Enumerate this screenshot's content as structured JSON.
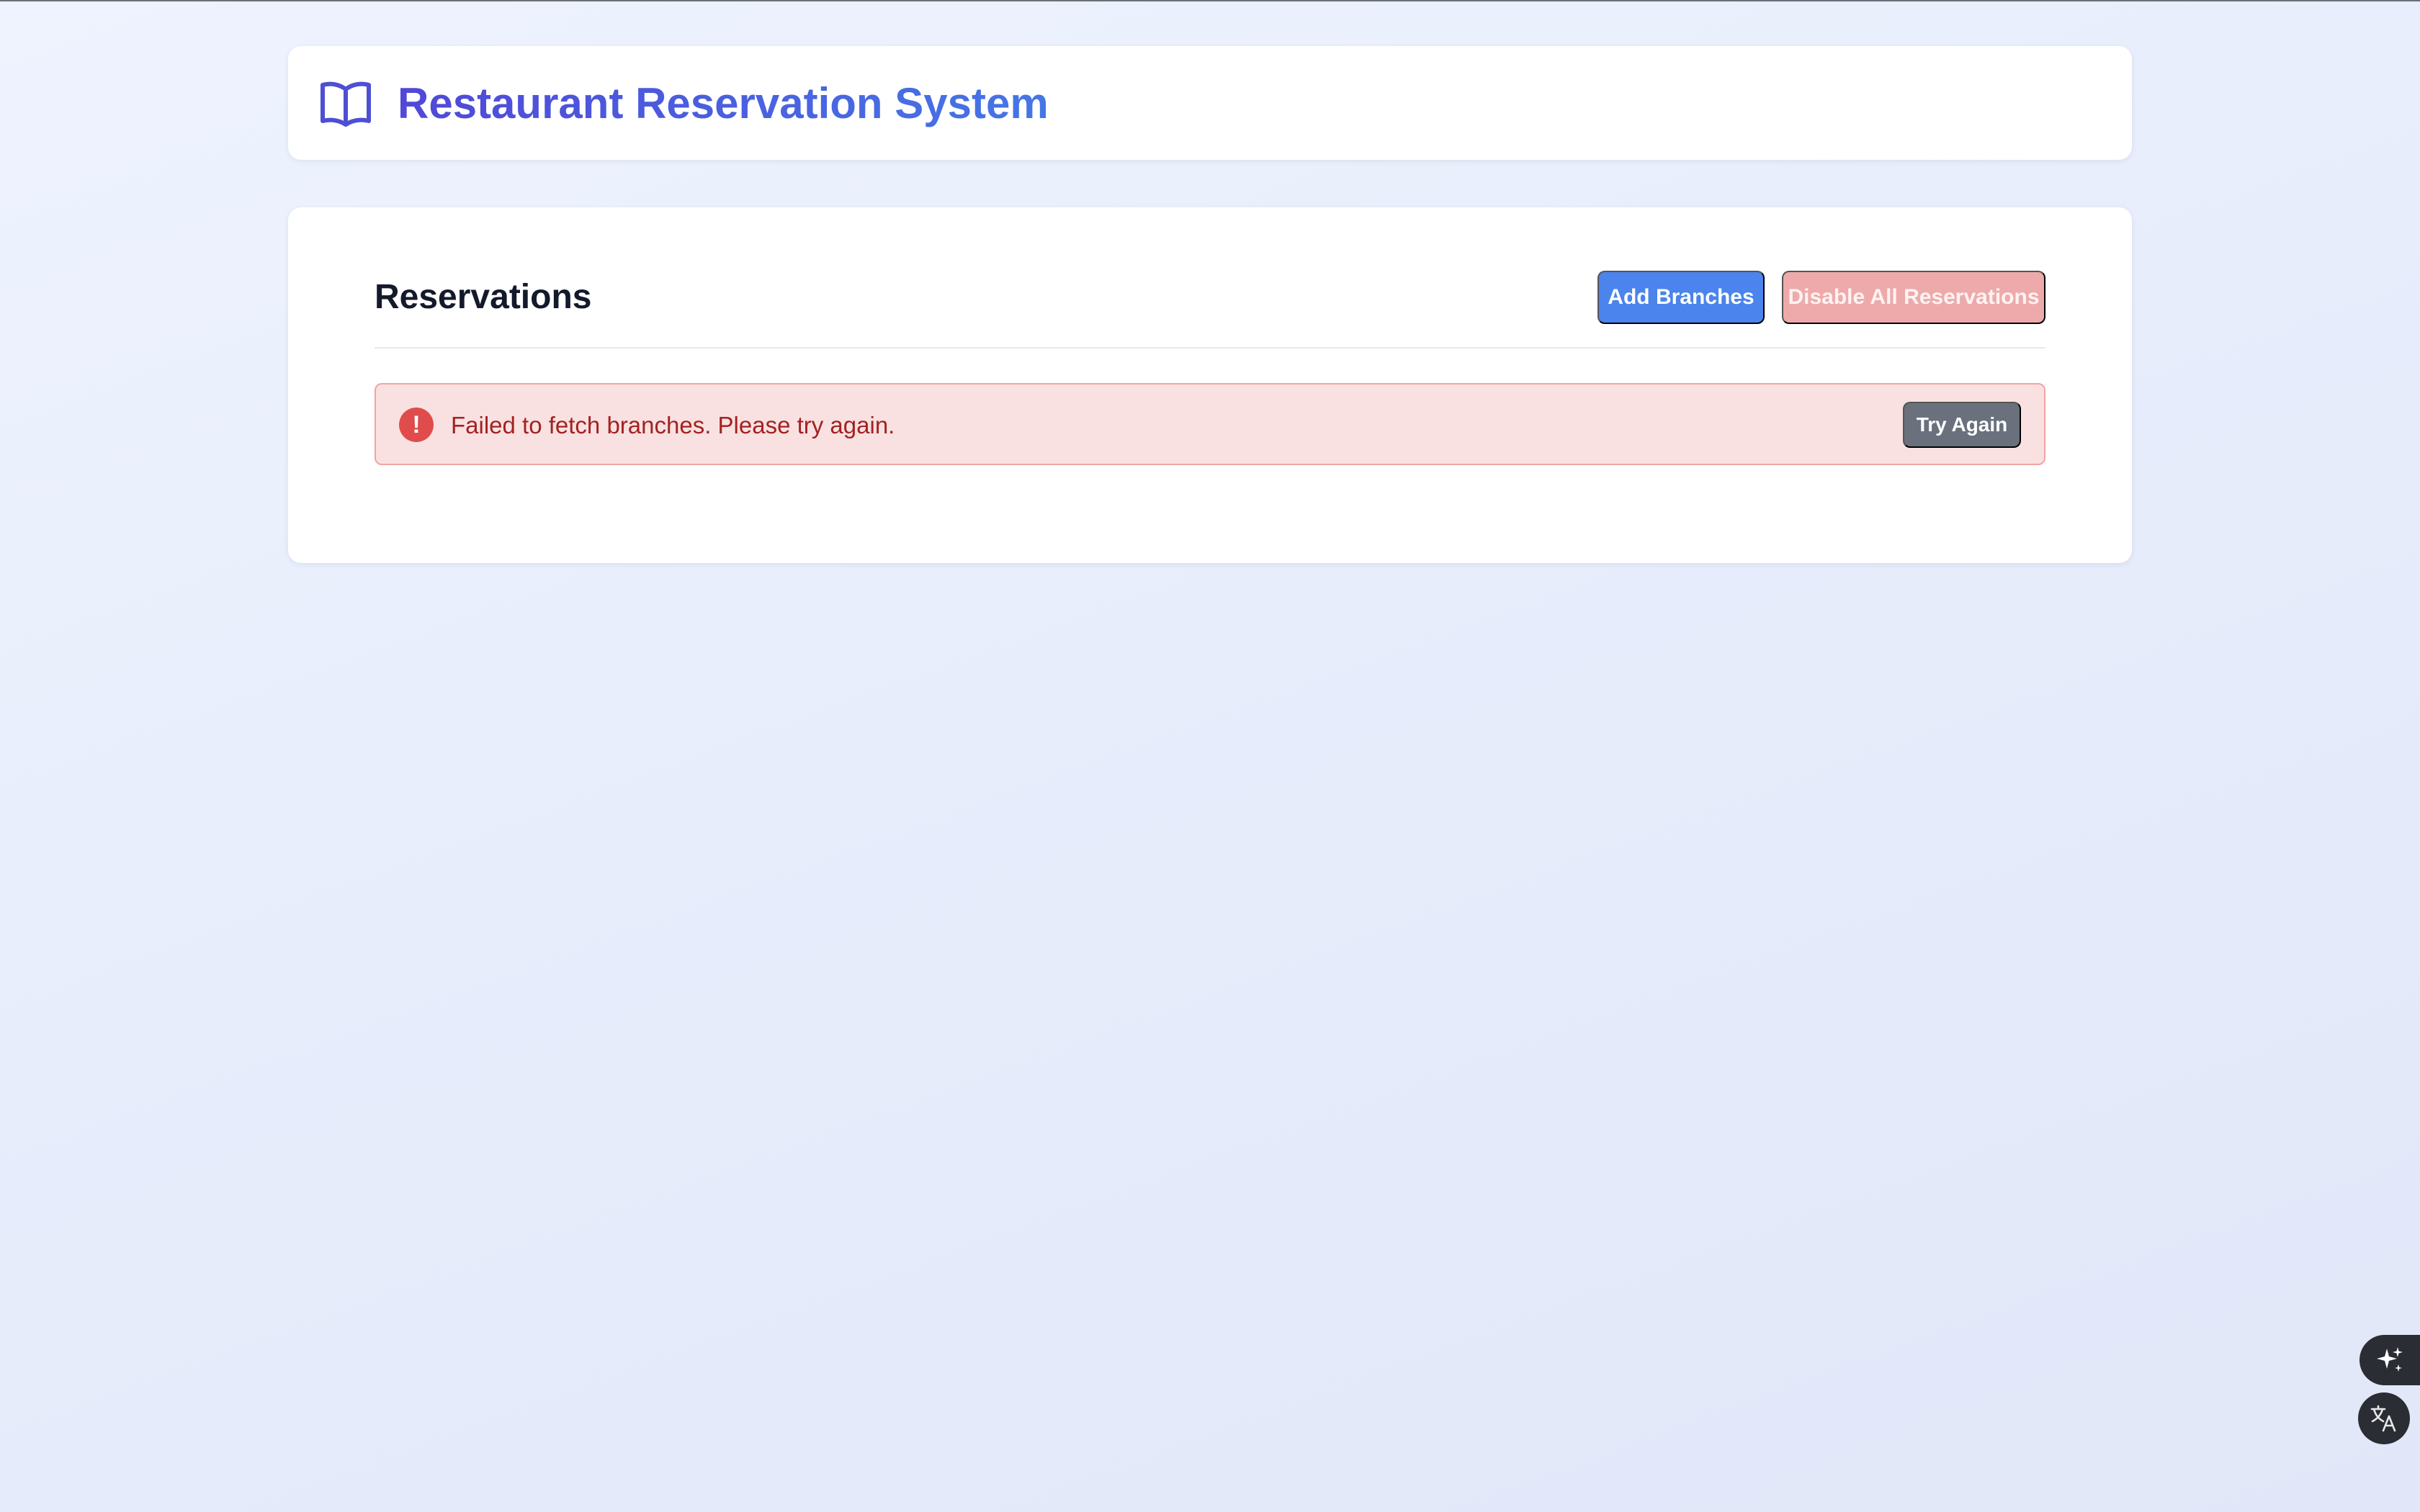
{
  "header": {
    "title": "Restaurant Reservation System",
    "logo_icon": "book-open-icon"
  },
  "reservations": {
    "title": "Reservations",
    "add_button_label": "Add Branches",
    "disable_button_label": "Disable All Reservations"
  },
  "error_alert": {
    "icon": "exclamation-circle-icon",
    "message": "Failed to fetch branches. Please try again.",
    "retry_label": "Try Again"
  },
  "floating_tools": {
    "sparkle_icon": "sparkle-icon",
    "translate_icon": "translate-icon"
  },
  "colors": {
    "primary": "#4a84ec",
    "title_gradient_start": "#5048d8",
    "title_gradient_end": "#4576e6",
    "danger_disabled": "#eeaaaa",
    "alert_background": "#fae1e1",
    "alert_text": "#a32222",
    "secondary": "#6a717d"
  }
}
